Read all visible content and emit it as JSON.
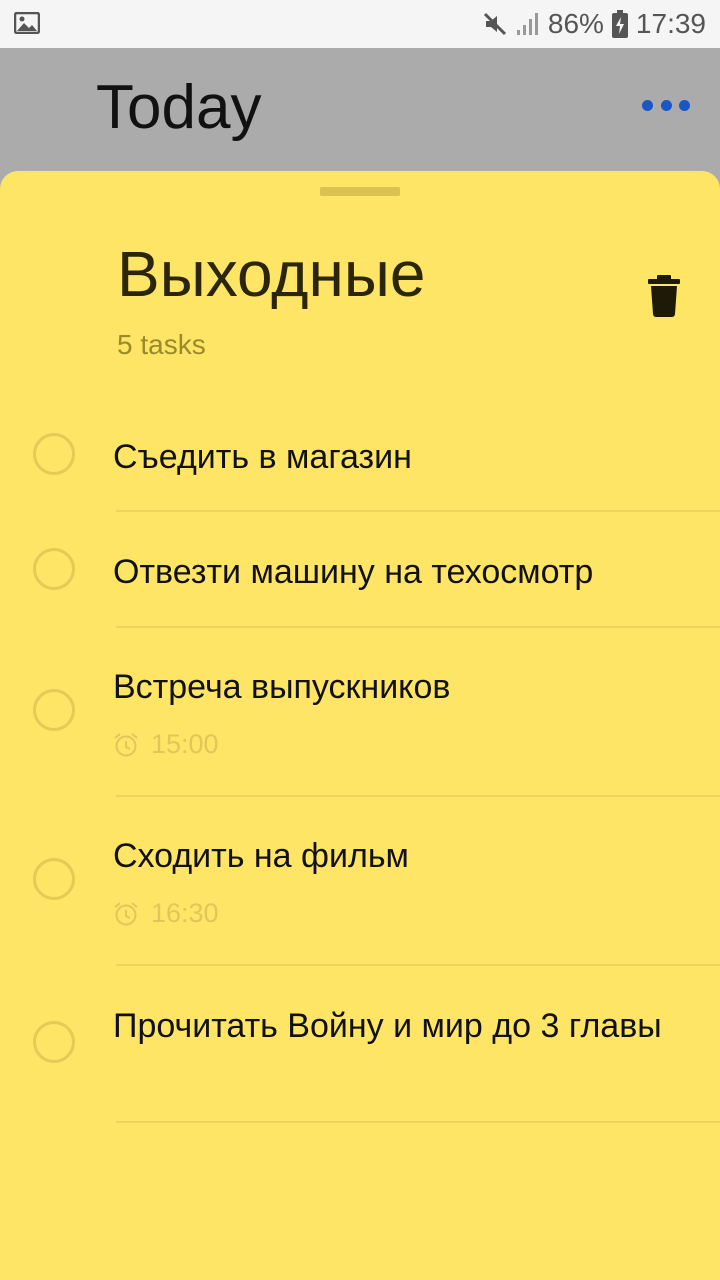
{
  "status_bar": {
    "battery": "86%",
    "time": "17:39",
    "icons": [
      "gallery-icon",
      "mute-icon",
      "signal-icon",
      "battery-charging-icon"
    ]
  },
  "header": {
    "title": "Today",
    "menu_icon": "more-horizontal-icon",
    "accent_color": "#1a56c4"
  },
  "list": {
    "title": "Выходные",
    "count_label": "5 tasks",
    "background_color": "#fee566",
    "delete_icon": "trash-icon",
    "tasks": [
      {
        "title": "Съедить в магазин"
      },
      {
        "title": "Отвезти машину на техосмотр"
      },
      {
        "title": "Встреча выпускников",
        "time": "15:00"
      },
      {
        "title": "Сходить на фильм",
        "time": "16:30"
      },
      {
        "title": "Прочитать Войну и мир до 3 главы"
      }
    ]
  }
}
